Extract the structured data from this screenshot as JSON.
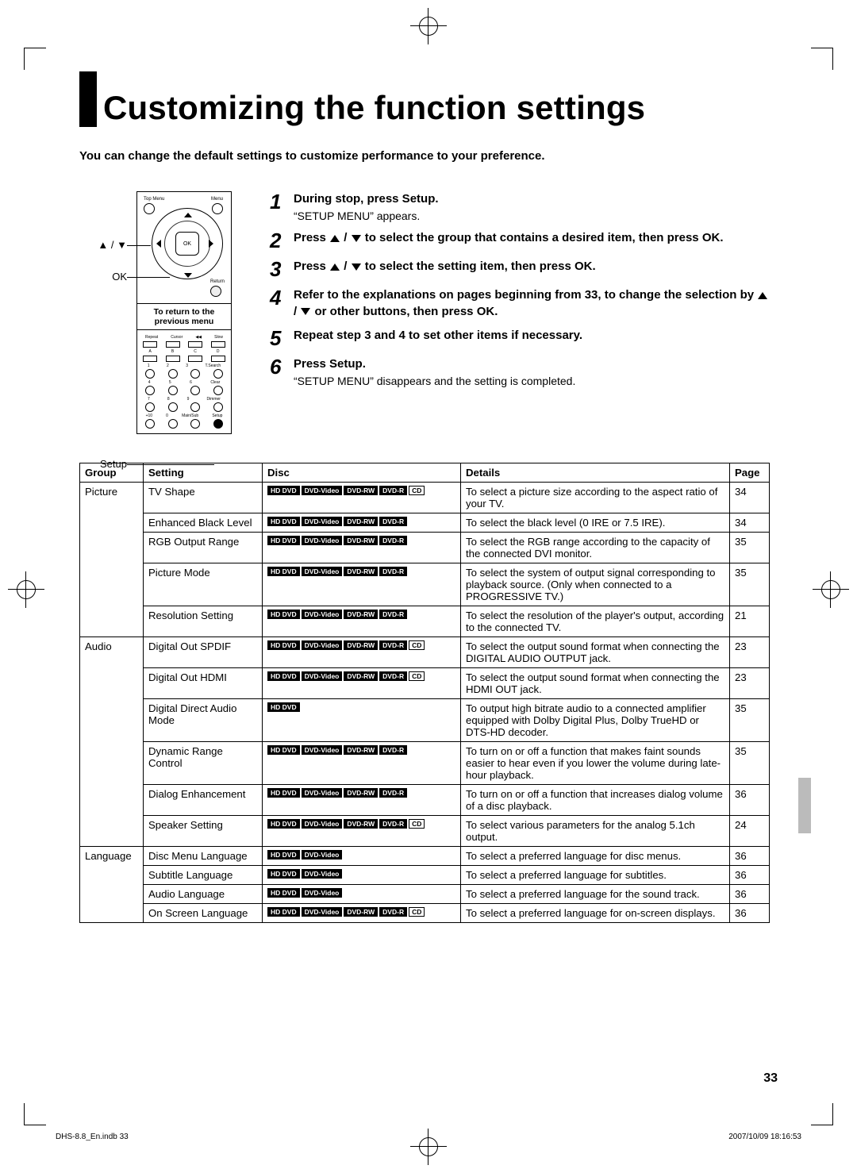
{
  "title": "Customizing the function settings",
  "intro": "You can change the default settings to customize performance to your preference.",
  "remote": {
    "arrows_label": "▲ / ▼",
    "ok_label": "OK",
    "ok_btn": "OK",
    "setup_label": "Setup",
    "return_box_l1": "To return to the",
    "return_box_l2": "previous menu",
    "top_menu": "Top Menu",
    "menu": "Menu",
    "return": "Return",
    "row1": [
      "Repeat",
      "Cursor",
      "◀◀",
      "Slow"
    ],
    "row2": [
      "A",
      "B",
      "C",
      "D"
    ],
    "row3": [
      "1",
      "2",
      "3",
      "T.Search"
    ],
    "row4": [
      "4",
      "5",
      "6",
      "Clear"
    ],
    "row5": [
      "7",
      "8",
      "9",
      "Dimmer"
    ],
    "row6": [
      "+10",
      "0",
      "Main/Sub",
      "Setup"
    ]
  },
  "steps": [
    {
      "n": "1",
      "title": "During stop, press Setup.",
      "sub": "“SETUP MENU” appears."
    },
    {
      "n": "2",
      "title": "Press ▲ / ▼ to select the group that contains a desired item, then press OK."
    },
    {
      "n": "3",
      "title": "Press ▲ / ▼ to select the setting item, then press OK."
    },
    {
      "n": "4",
      "title": "Refer to the explanations on pages beginning from 33, to change the selection by ▲ / ▼ or other buttons, then press OK."
    },
    {
      "n": "5",
      "title": "Repeat step 3 and 4 to set other items if necessary."
    },
    {
      "n": "6",
      "title": "Press Setup.",
      "sub": "“SETUP MENU” disappears and the setting is completed."
    }
  ],
  "headers": {
    "group": "Group",
    "setting": "Setting",
    "disc": "Disc",
    "details": "Details",
    "page": "Page"
  },
  "badges": {
    "hddvd": "HD DVD",
    "dvdvideo": "DVD-Video",
    "dvdrw": "DVD-RW",
    "dvdr": "DVD-R",
    "cd": "CD"
  },
  "groups": [
    {
      "name": "Picture",
      "rows": [
        {
          "setting": "TV Shape",
          "discs": [
            "hddvd",
            "dvdvideo",
            "dvdrw",
            "dvdr",
            "cd"
          ],
          "details": "To select a picture size according to the aspect ratio of your TV.",
          "page": "34"
        },
        {
          "setting": "Enhanced Black Level",
          "discs": [
            "hddvd",
            "dvdvideo",
            "dvdrw",
            "dvdr"
          ],
          "details": "To select the black level (0 IRE or 7.5 IRE).",
          "page": "34"
        },
        {
          "setting": "RGB Output Range",
          "discs": [
            "hddvd",
            "dvdvideo",
            "dvdrw",
            "dvdr"
          ],
          "details": "To select the RGB range according to the capacity of the connected DVI monitor.",
          "page": "35"
        },
        {
          "setting": "Picture Mode",
          "discs": [
            "hddvd",
            "dvdvideo",
            "dvdrw",
            "dvdr"
          ],
          "details": "To select the system of output signal corresponding to playback source. (Only when connected to a PROGRESSIVE TV.)",
          "page": "35"
        },
        {
          "setting": "Resolution Setting",
          "discs": [
            "hddvd",
            "dvdvideo",
            "dvdrw",
            "dvdr"
          ],
          "details": "To select the resolution of the player's output, according to the connected TV.",
          "page": "21"
        }
      ]
    },
    {
      "name": "Audio",
      "rows": [
        {
          "setting": "Digital Out SPDIF",
          "discs": [
            "hddvd",
            "dvdvideo",
            "dvdrw",
            "dvdr",
            "cd"
          ],
          "details": "To select the output sound format when connecting the DIGITAL AUDIO OUTPUT jack.",
          "page": "23"
        },
        {
          "setting": "Digital Out HDMI",
          "discs": [
            "hddvd",
            "dvdvideo",
            "dvdrw",
            "dvdr",
            "cd"
          ],
          "details": "To select the output sound format when connecting the HDMI OUT jack.",
          "page": "23"
        },
        {
          "setting": "Digital Direct Audio Mode",
          "discs": [
            "hddvd"
          ],
          "details": "To output high bitrate audio to a connected amplifier equipped with Dolby Digital Plus, Dolby TrueHD or DTS-HD decoder.",
          "page": "35"
        },
        {
          "setting": "Dynamic Range Control",
          "discs": [
            "hddvd",
            "dvdvideo",
            "dvdrw",
            "dvdr"
          ],
          "details": "To turn on or off a function that makes faint sounds easier to hear even if you lower the volume during late-hour playback.",
          "page": "35"
        },
        {
          "setting": "Dialog Enhancement",
          "discs": [
            "hddvd",
            "dvdvideo",
            "dvdrw",
            "dvdr"
          ],
          "details": "To turn on or off a function that increases dialog volume of a disc playback.",
          "page": "36"
        },
        {
          "setting": "Speaker Setting",
          "discs": [
            "hddvd",
            "dvdvideo",
            "dvdrw",
            "dvdr",
            "cd"
          ],
          "details": "To select various parameters for the analog 5.1ch output.",
          "page": "24"
        }
      ]
    },
    {
      "name": "Language",
      "rows": [
        {
          "setting": "Disc Menu Language",
          "discs": [
            "hddvd",
            "dvdvideo"
          ],
          "details": "To select a preferred language for disc menus.",
          "page": "36"
        },
        {
          "setting": "Subtitle Language",
          "discs": [
            "hddvd",
            "dvdvideo"
          ],
          "details": "To select a preferred language for subtitles.",
          "page": "36"
        },
        {
          "setting": "Audio Language",
          "discs": [
            "hddvd",
            "dvdvideo"
          ],
          "details": "To select a preferred language for the sound track.",
          "page": "36"
        },
        {
          "setting": "On Screen Language",
          "discs": [
            "hddvd",
            "dvdvideo",
            "dvdrw",
            "dvdr",
            "cd"
          ],
          "details": "To select a preferred language for on-screen displays.",
          "page": "36"
        }
      ]
    }
  ],
  "page_number": "33",
  "footer": {
    "file": "DHS-8.8_En.indb   33",
    "date": "2007/10/09   18:16:53"
  }
}
